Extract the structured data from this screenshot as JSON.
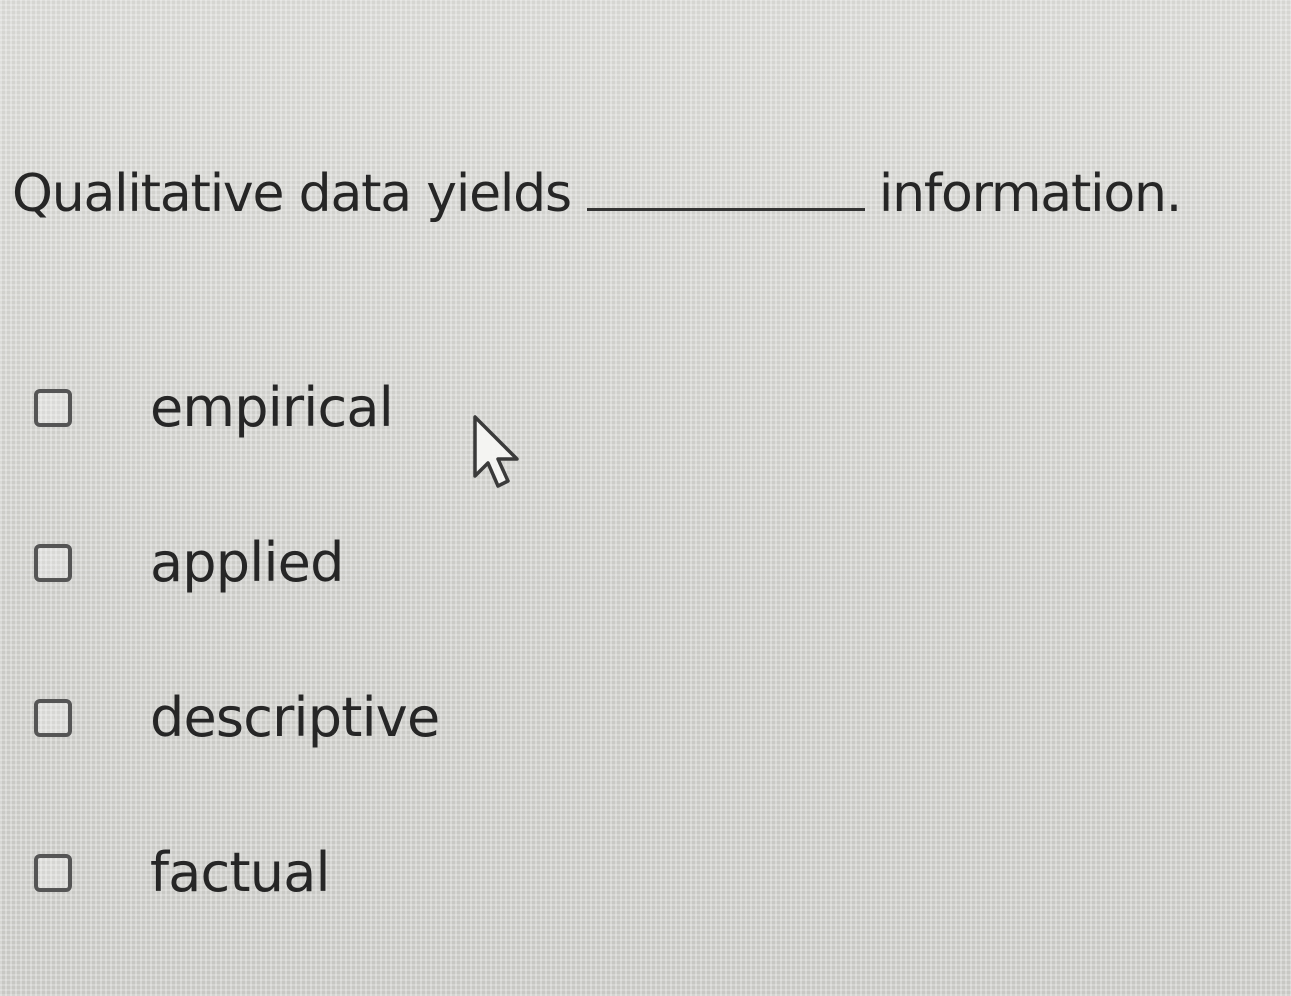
{
  "question": {
    "prefix": "Qualitative data yields",
    "suffix": "information."
  },
  "options": [
    {
      "label": "empirical",
      "checked": false
    },
    {
      "label": "applied",
      "checked": false
    },
    {
      "label": "descriptive",
      "checked": false
    },
    {
      "label": "factual",
      "checked": false
    }
  ],
  "cursor": {
    "icon": "arrow-pointer-icon"
  }
}
